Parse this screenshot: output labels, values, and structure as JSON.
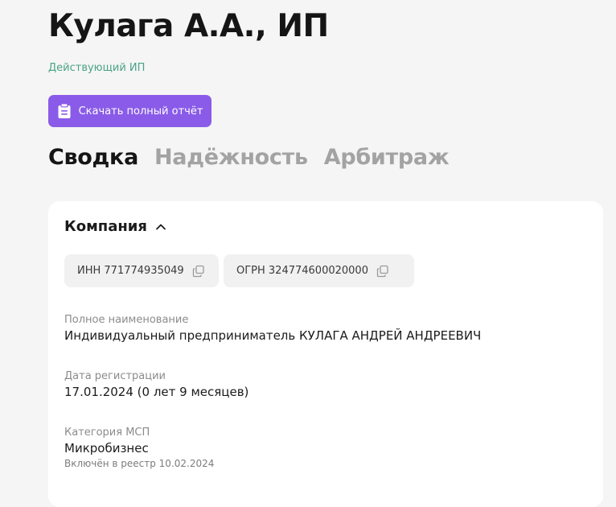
{
  "header": {
    "title": "Кулага А.А., ИП",
    "status": "Действующий ИП",
    "download_label": "Скачать полный отчёт"
  },
  "tabs": [
    {
      "label": "Сводка",
      "active": true
    },
    {
      "label": "Надёжность",
      "active": false
    },
    {
      "label": "Арбитраж",
      "active": false
    }
  ],
  "company": {
    "section_title": "Компания",
    "inn": "ИНН 771774935049",
    "ogrn": "ОГРН 324774600020000",
    "full_name_label": "Полное наименование",
    "full_name_value": "Индивидуальный предприниматель КУЛАГА АНДРЕЙ АНДРЕЕВИЧ",
    "reg_date_label": "Дата регистрации",
    "reg_date_value": "17.01.2024 (0 лет 9 месяцев)",
    "msp_label": "Категория МСП",
    "msp_value": "Микробизнес",
    "msp_note": "Включён в реестр 10.02.2024"
  },
  "colors": {
    "accent": "#8a5be8",
    "status": "#4aa286",
    "background": "#f5f5f5",
    "card": "#ffffff"
  },
  "icons": {
    "download": "clipboard-icon",
    "collapse": "chevron-up-icon",
    "copy": "copy-icon"
  }
}
